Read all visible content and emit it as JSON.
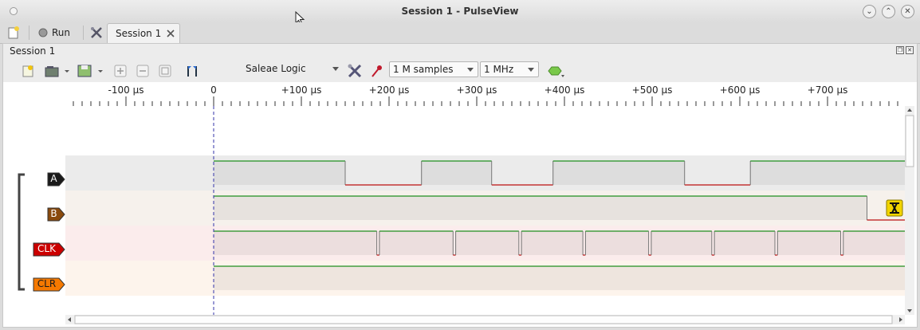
{
  "window": {
    "title": "Session 1 - PulseView"
  },
  "tabs": {
    "run_label": "Run",
    "session_tab_label": "Session 1"
  },
  "dock": {
    "title": "Session 1"
  },
  "toolbar": {
    "device": "Saleae Logic",
    "samples": "1 M samples",
    "samplerate": "1 MHz"
  },
  "ruler": {
    "ticks": [
      {
        "label": "-100 µs",
        "us": -100
      },
      {
        "label": "0",
        "us": 0
      },
      {
        "label": "+100 µs",
        "us": 100
      },
      {
        "label": "+200 µs",
        "us": 200
      },
      {
        "label": "+300 µs",
        "us": 300
      },
      {
        "label": "+400 µs",
        "us": 400
      },
      {
        "label": "+500 µs",
        "us": 500
      },
      {
        "label": "+600 µs",
        "us": 600
      },
      {
        "label": "+700 µs",
        "us": 700
      }
    ]
  },
  "channels": [
    {
      "name": "A",
      "color": "#1a1a1a",
      "text_color": "#ffffff",
      "bg": "#ebebeb",
      "edges_us": [
        0,
        150,
        237,
        317,
        387,
        537,
        612
      ],
      "initial": 1
    },
    {
      "name": "B",
      "color": "#8a4a0d",
      "text_color": "#ffffff",
      "bg": "#f6f1ec",
      "edges_us": [
        0,
        745
      ],
      "initial": 1
    },
    {
      "name": "CLK",
      "color": "#cc0000",
      "text_color": "#ffffff",
      "bg": "#fbecec",
      "edges_us": [
        0,
        186,
        189,
        273,
        276,
        348,
        351,
        421,
        424,
        496,
        499,
        568,
        571,
        640,
        643,
        715,
        718
      ],
      "initial": 1
    },
    {
      "name": "CLR",
      "color": "#f57900",
      "text_color": "#1a1a1a",
      "bg": "#fdf4ec",
      "edges_us": [
        0
      ],
      "initial": 1
    }
  ],
  "colors": {
    "high": "#1f8f1f",
    "low": "#bb1111",
    "cursor": "#3333aa",
    "warning": "#f2d400"
  },
  "icons": [
    "new-session-icon",
    "run-icon",
    "settings-icon",
    "close-icon",
    "open-icon",
    "save-icon",
    "zoom-in-icon",
    "zoom-out-icon",
    "zoom-fit-icon",
    "cursor-icon",
    "device-config-icon",
    "probe-icon",
    "decoder-icon",
    "warning-icon"
  ]
}
